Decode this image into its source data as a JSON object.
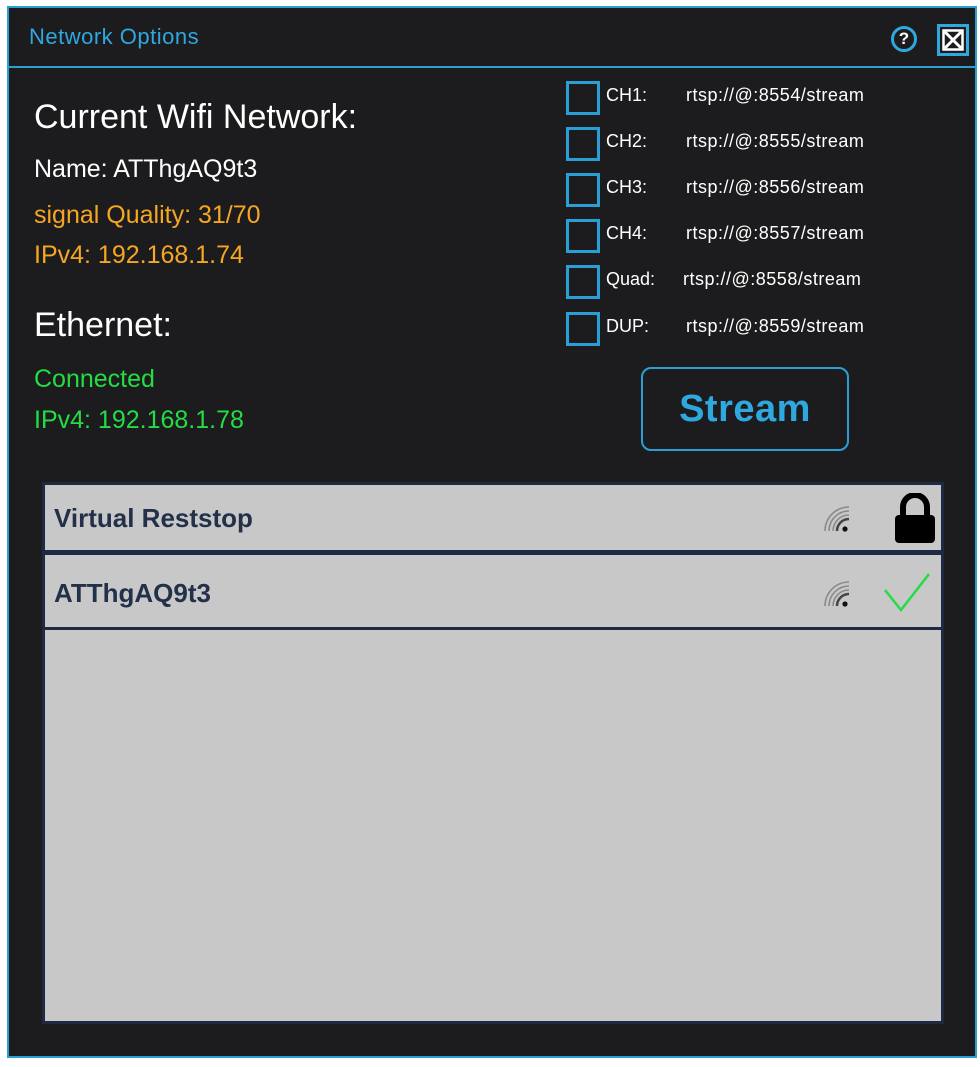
{
  "window": {
    "title": "Network Options",
    "help_label": "?"
  },
  "wifi": {
    "heading": "Current Wifi Network:",
    "name": "Name: ATThgAQ9t3",
    "signal_quality": "signal Quality: 31/70",
    "ipv4": "IPv4: 192.168.1.74"
  },
  "ethernet": {
    "heading": "Ethernet:",
    "status": "Connected",
    "ipv4": "IPv4: 192.168.1.78"
  },
  "channels": [
    {
      "label": "CH1:",
      "url": "rtsp://@:8554/stream",
      "checked": false
    },
    {
      "label": "CH2:",
      "url": "rtsp://@:8555/stream",
      "checked": false
    },
    {
      "label": "CH3:",
      "url": "rtsp://@:8556/stream",
      "checked": false
    },
    {
      "label": "CH4:",
      "url": "rtsp://@:8557/stream",
      "checked": false
    },
    {
      "label": "Quad:",
      "url": "rtsp://@:8558/stream",
      "checked": false
    },
    {
      "label": "DUP:",
      "url": "rtsp://@:8559/stream",
      "checked": false
    }
  ],
  "stream_button_label": "Stream",
  "networks": [
    {
      "name": "Virtual Reststop",
      "signal_icon": "wifi-signal-icon",
      "status_icon": "lock-icon"
    },
    {
      "name": "ATThgAQ9t3",
      "signal_icon": "wifi-signal-icon",
      "status_icon": "checkmark-icon"
    }
  ],
  "colors": {
    "accent": "#2a9fd6",
    "background": "#1c1c1e",
    "warning": "#f5a623",
    "success": "#22dd44",
    "list_background": "#c8c8c8",
    "list_text": "#23304a"
  }
}
